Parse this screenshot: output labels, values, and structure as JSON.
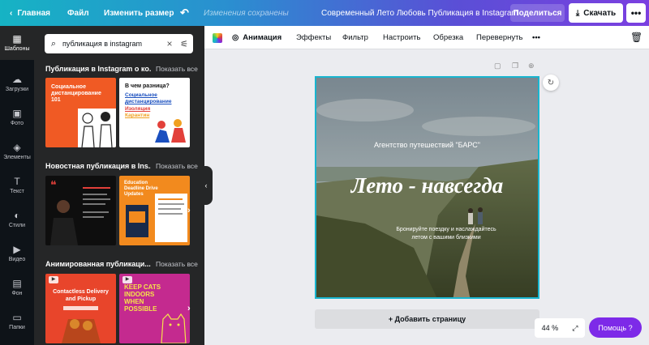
{
  "topbar": {
    "home": "Главная",
    "file": "Файл",
    "resize": "Изменить размер",
    "undo_icon": "undo-icon",
    "saved_status": "Изменения сохранены",
    "title": "Современный Лето Любовь Публикация в Instagram",
    "share": "Поделиться",
    "download": "Скачать",
    "more": "•••"
  },
  "rail": [
    {
      "label": "Шаблоны",
      "icon": "▦"
    },
    {
      "label": "Загрузки",
      "icon": "☁"
    },
    {
      "label": "Фото",
      "icon": "▣"
    },
    {
      "label": "Элементы",
      "icon": "◈"
    },
    {
      "label": "Текст",
      "icon": "T"
    },
    {
      "label": "Стили",
      "icon": "◐"
    },
    {
      "label": "Видео",
      "icon": "▶"
    },
    {
      "label": "Фон",
      "icon": "▤"
    },
    {
      "label": "Папки",
      "icon": "▭"
    }
  ],
  "panel": {
    "search_value": "публикация в instagram",
    "sections": [
      {
        "title": "Публикация в Instagram о ко...",
        "show_all": "Показать все"
      },
      {
        "title": "Новостная публикация в Ins...",
        "show_all": "Показать все"
      },
      {
        "title": "Анимированная публикаци...",
        "show_all": "Показать все"
      }
    ],
    "thumbs": {
      "t1": "Социальное дистанцирование 101",
      "t2a": "В чем разница?",
      "t2b": "Социальное дистанцирование",
      "t2c": "Изоляция",
      "t2d": "Карантин",
      "t4": "Education Deadline Drive Updates",
      "t5a": "Contactless Delivery and Pickup",
      "t6": "KEEP CATS INDOORS WHEN POSSIBLE"
    }
  },
  "toolbar": {
    "animation": "Анимация",
    "effects": "Эффекты",
    "filter": "Фильтр",
    "adjust": "Настроить",
    "crop": "Обрезка",
    "flip": "Перевернуть",
    "more": "•••"
  },
  "design": {
    "agency": "Агентство путешествий \"БАРС\"",
    "headline": "Лето - навсегда",
    "sub_line1": "Бронируйте поездку и наслаждайтесь",
    "sub_line2": "летом с вашими близкими"
  },
  "add_page": "+ Добавить страницу",
  "zoom": "44 %",
  "help": "Помощь  ?",
  "colors": {
    "accent": "#7d2ae8",
    "selection": "#19b5cf"
  }
}
